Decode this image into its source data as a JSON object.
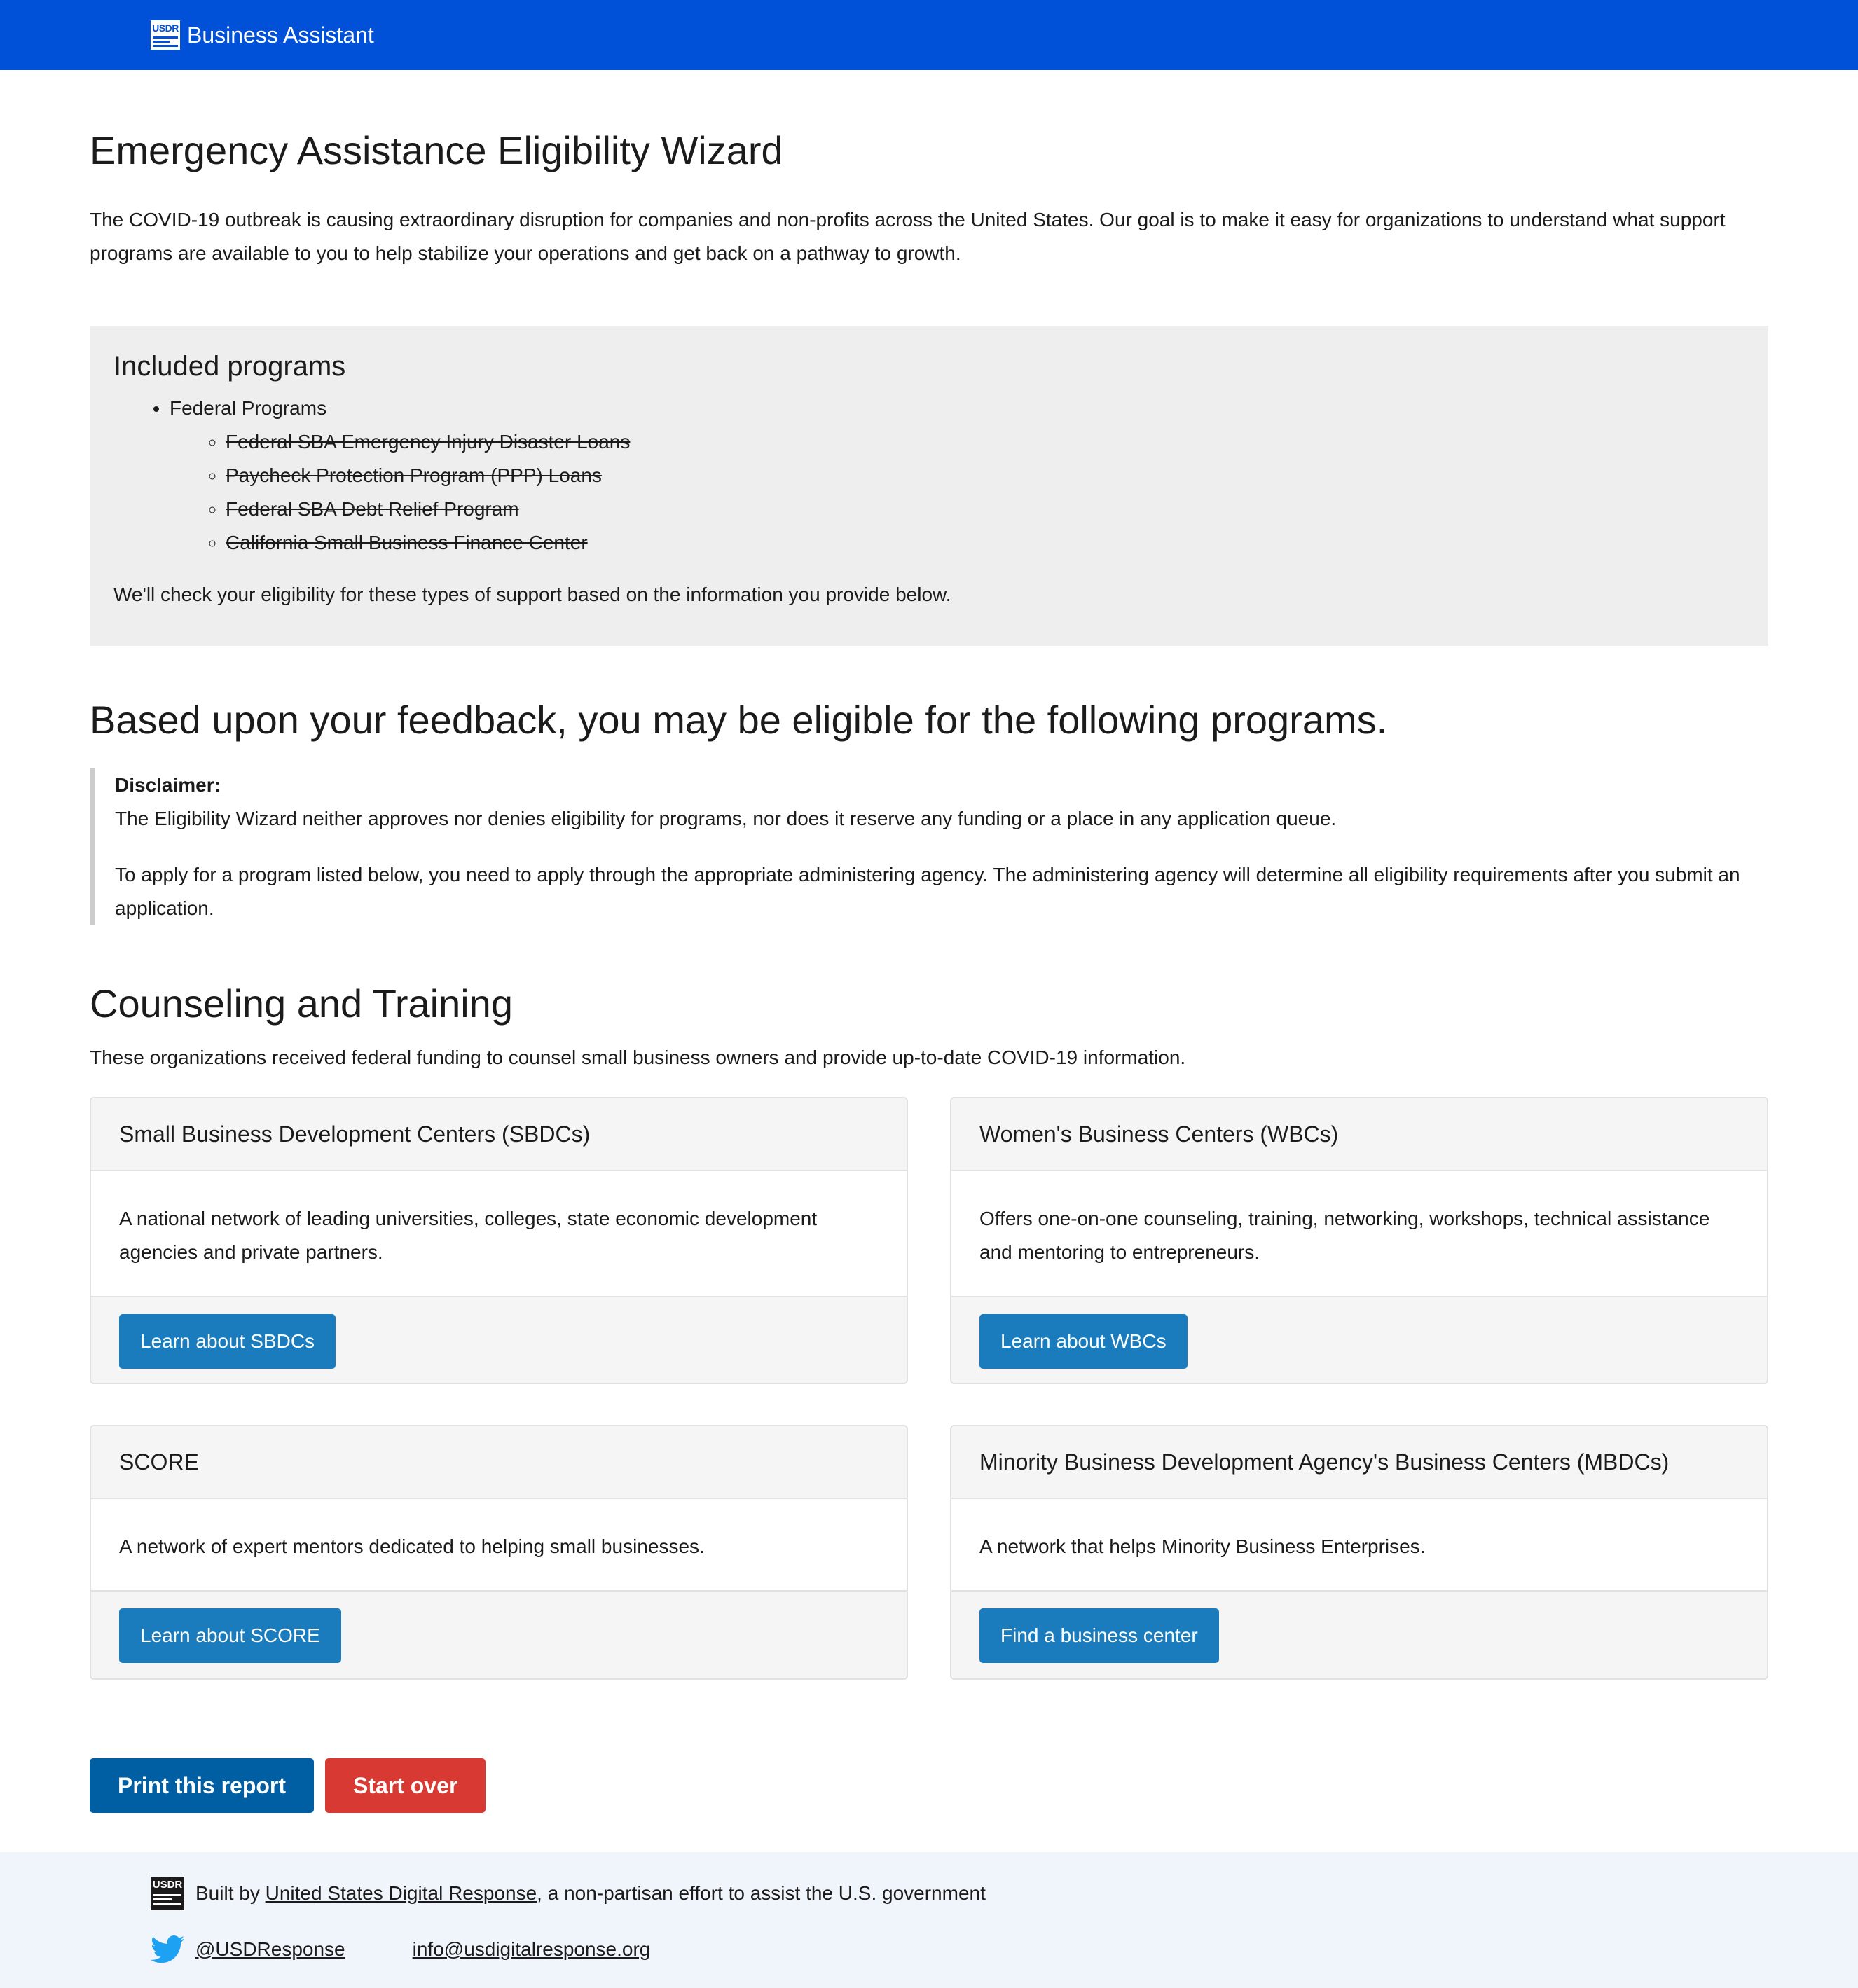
{
  "header": {
    "logo_text": "USDR",
    "title": "Business Assistant"
  },
  "page": {
    "title": "Emergency Assistance Eligibility Wizard",
    "intro": "The COVID-19 outbreak is causing extraordinary disruption for companies and non-profits across the United States. Our goal is to make it easy for organizations to understand what support programs are available to you to help stabilize your operations and get back on a pathway to growth."
  },
  "programs": {
    "heading": "Included programs",
    "group": "Federal Programs",
    "items": [
      "Federal SBA Emergency Injury Disaster Loans",
      "Paycheck Protection Program (PPP) Loans",
      "Federal SBA Debt Relief Program",
      "California Small Business Finance Center"
    ],
    "note": "We'll check your eligibility for these types of support based on the information you provide below."
  },
  "results": {
    "heading": "Based upon your feedback, you may be eligible for the following programs.",
    "disclaimer_title": "Disclaimer:",
    "disclaimer_p1": "The Eligibility Wizard neither approves nor denies eligibility for programs, nor does it reserve any funding or a place in any application queue.",
    "disclaimer_p2": "To apply for a program listed below, you need to apply through the appropriate administering agency. The administering agency will determine all eligibility requirements after you submit an application."
  },
  "counseling": {
    "heading": "Counseling and Training",
    "description": "These organizations received federal funding to counsel small business owners and provide up-to-date COVID-19 information.",
    "cards": [
      {
        "title": "Small Business Development Centers (SBDCs)",
        "body": "A national network of leading universities, colleges, state economic development agencies and private partners.",
        "button": "Learn about SBDCs"
      },
      {
        "title": "Women's Business Centers (WBCs)",
        "body": "Offers one-on-one counseling, training, networking, workshops, technical assistance and mentoring to entrepreneurs.",
        "button": "Learn about WBCs"
      },
      {
        "title": "SCORE",
        "body": "A network of expert mentors dedicated to helping small businesses.",
        "button": "Learn about SCORE"
      },
      {
        "title": "Minority Business Development Agency's Business Centers (MBDCs)",
        "body": "A network that helps Minority Business Enterprises.",
        "button": "Find a business center"
      }
    ]
  },
  "actions": {
    "print": "Print this report",
    "start_over": "Start over"
  },
  "footer": {
    "logo_text": "USDR",
    "built_by": "Built by ",
    "org_link": "United States Digital Response",
    "built_suffix": ", a non-partisan effort to assist the U.S. government",
    "twitter_handle": "@USDResponse",
    "email": "info@usdigitalresponse.org"
  },
  "colors": {
    "header_bg": "#0050d8",
    "button_blue": "#1a7bbd",
    "print_button": "#005ea2",
    "start_over_button": "#d83933",
    "footer_bg": "#f0f4fb",
    "twitter_blue": "#1da1f2"
  },
  "icons": {
    "twitter": "twitter-bird-icon",
    "logo": "usdr-logo-icon"
  }
}
